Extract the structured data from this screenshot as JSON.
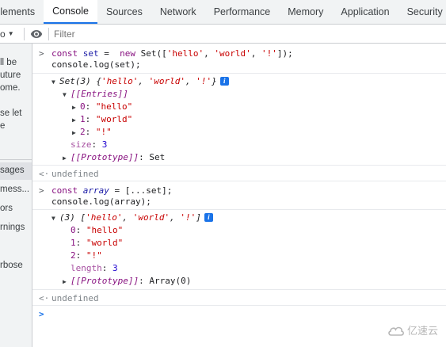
{
  "tabs": [
    {
      "label": "Elements",
      "active": false
    },
    {
      "label": "Console",
      "active": true
    },
    {
      "label": "Sources",
      "active": false
    },
    {
      "label": "Network",
      "active": false
    },
    {
      "label": "Performance",
      "active": false
    },
    {
      "label": "Memory",
      "active": false
    },
    {
      "label": "Application",
      "active": false
    },
    {
      "label": "Security",
      "active": false
    }
  ],
  "filterbar": {
    "context": "o",
    "filter_placeholder": "Filter"
  },
  "sidebar": {
    "lines": [
      "ll be",
      "uture",
      "ome.",
      "se let",
      "e",
      "sages",
      "mess...",
      "ors",
      "rnings",
      "rbose"
    ]
  },
  "console": {
    "block1": {
      "input_l1": [
        "const",
        "set",
        " = ",
        "new",
        " Set([",
        "'hello'",
        ", ",
        "'world'",
        ", ",
        "'!'",
        "]);"
      ],
      "input_l2": "console.log(set);",
      "summary": [
        "Set(3) {",
        "'hello'",
        ", ",
        "'world'",
        ", ",
        "'!'",
        "}"
      ],
      "entries_label": "[[Entries]]",
      "entries": [
        {
          "key": "0",
          "value": "\"hello\""
        },
        {
          "key": "1",
          "value": "\"world\""
        },
        {
          "key": "2",
          "value": "\"!\""
        }
      ],
      "size_key": "size",
      "size_val": "3",
      "proto_key": "[[Prototype]]",
      "proto_val": "Set",
      "result": "undefined"
    },
    "block2": {
      "input_l1": [
        "const",
        "array",
        " = [...set];"
      ],
      "input_l2": "console.log(array);",
      "summary": [
        "(3) [",
        "'hello'",
        ", ",
        "'world'",
        ", ",
        "'!'",
        "]"
      ],
      "items": [
        {
          "key": "0",
          "value": "\"hello\""
        },
        {
          "key": "1",
          "value": "\"world\""
        },
        {
          "key": "2",
          "value": "\"!\""
        }
      ],
      "length_key": "length",
      "length_val": "3",
      "proto_key": "[[Prototype]]",
      "proto_val": "Array(0)",
      "result": "undefined"
    }
  },
  "watermark": "亿速云",
  "colors": {
    "accent": "#1a73e8",
    "keyword": "#881280",
    "string": "#c80000",
    "number": "#1c00cf"
  }
}
